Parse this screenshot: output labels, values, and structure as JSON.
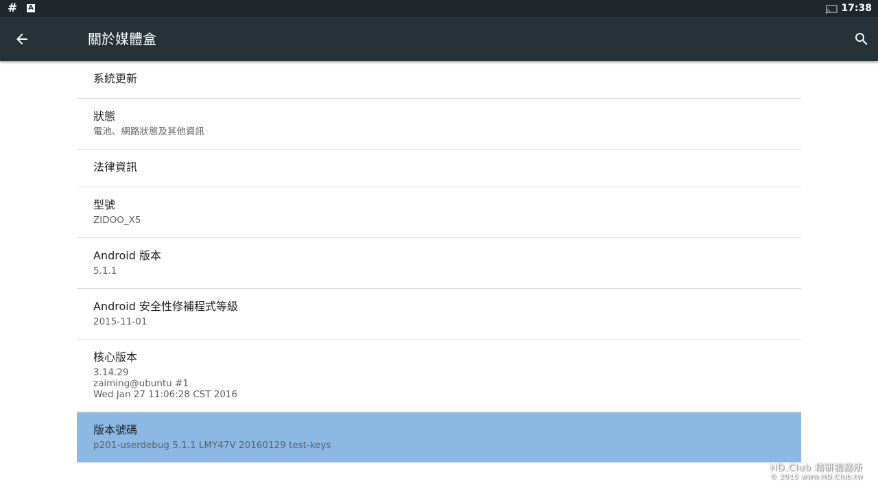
{
  "status_bar": {
    "left_icons": [
      "hash-icon",
      "a-notification-icon"
    ],
    "right_icons": [
      "cast-icon"
    ],
    "time": "17:38"
  },
  "app_bar": {
    "title": "關於媒體盒",
    "back_icon": "arrow-back-icon",
    "search_icon": "search-icon",
    "background": "#263238"
  },
  "settings": {
    "system_update": {
      "title": "系統更新"
    },
    "status": {
      "title": "狀態",
      "summary": "電池、網路狀態及其他資訊"
    },
    "legal": {
      "title": "法律資訊"
    },
    "model": {
      "title": "型號",
      "summary": "ZIDOO_X5"
    },
    "android_version": {
      "title": "Android 版本",
      "summary": "5.1.1"
    },
    "security_patch": {
      "title": "Android 安全性修補程式等級",
      "summary": "2015-11-01"
    },
    "kernel": {
      "title": "核心版本",
      "line1": "3.14.29",
      "line2": "zaiming@ubuntu #1",
      "line3": "Wed Jan 27 11:06:28 CST 2016"
    },
    "build_number": {
      "title": "版本號碼",
      "summary": "p201-userdebug 5.1.1 LMY47V 20160129 test-keys"
    }
  },
  "watermark": {
    "line1": "HD.Club 精研視務所",
    "line2": "© 2015 www.HD.Club.tw"
  },
  "colors": {
    "status_bar": "#1f272c",
    "selected_row": "#8cb8e4",
    "divider": "#dcdcdc"
  }
}
